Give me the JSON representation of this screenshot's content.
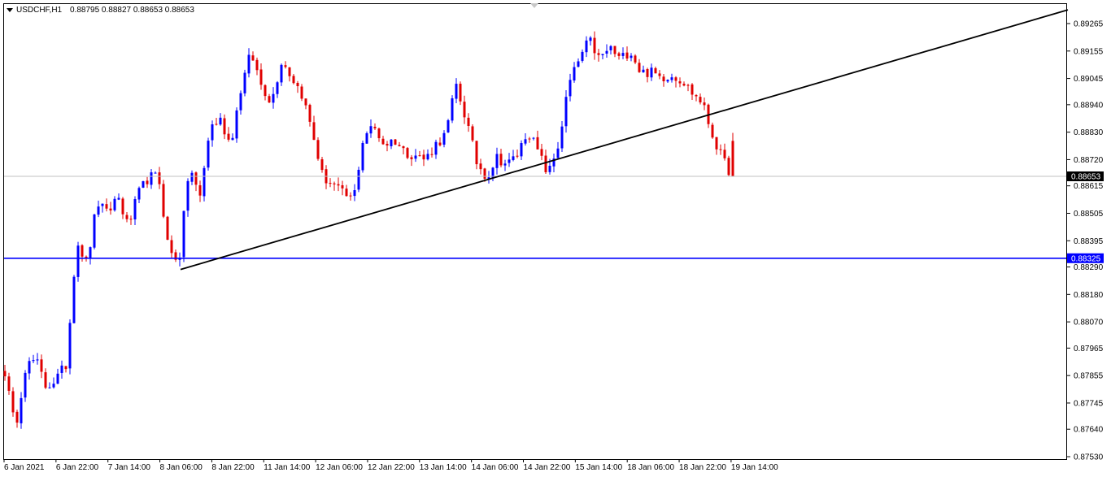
{
  "header": {
    "symbol_timeframe": "USDCHF,H1",
    "ohlc": "0.88795 0.88827 0.88653 0.88653"
  },
  "colors": {
    "bull": "#0000ff",
    "bear": "#e00000",
    "grid_frame": "#000000",
    "horizontal_level": "#0000ff",
    "bid_line": "#c0c0c0"
  },
  "chart_data": {
    "type": "candlestick",
    "symbol": "USDCHF",
    "timeframe": "H1",
    "y_ticks": [
      "0.89265",
      "0.89155",
      "0.89045",
      "0.88940",
      "0.88830",
      "0.88720",
      "0.88615",
      "0.88505",
      "0.88395",
      "0.88290",
      "0.88180",
      "0.88070",
      "0.87965",
      "0.87855",
      "0.87745",
      "0.87640",
      "0.87530"
    ],
    "x_ticks": [
      "6 Jan 2021",
      "6 Jan 22:00",
      "7 Jan 14:00",
      "8 Jan 06:00",
      "8 Jan 22:00",
      "11 Jan 14:00",
      "12 Jan 06:00",
      "12 Jan 22:00",
      "13 Jan 14:00",
      "14 Jan 06:00",
      "14 Jan 22:00",
      "15 Jan 14:00",
      "18 Jan 06:00",
      "18 Jan 22:00",
      "19 Jan 14:00"
    ],
    "ylim": [
      0.8753,
      0.8933
    ],
    "current_price": "0.88653",
    "horizontal_level": "0.88325",
    "trendline": {
      "from_price": 0.8828,
      "to_price": 0.8932
    },
    "close_anchors": [
      0.8787,
      0.8764,
      0.8789,
      0.8792,
      0.8781,
      0.8784,
      0.879,
      0.884,
      0.883,
      0.8855,
      0.885,
      0.8858,
      0.8845,
      0.8858,
      0.8865,
      0.8865,
      0.8835,
      0.8832,
      0.887,
      0.8856,
      0.8885,
      0.8888,
      0.8878,
      0.89,
      0.8915,
      0.8902,
      0.8895,
      0.8912,
      0.8905,
      0.8898,
      0.8883,
      0.8865,
      0.8862,
      0.8858,
      0.8856,
      0.8882,
      0.8885,
      0.8878,
      0.888,
      0.8875,
      0.8874,
      0.8872,
      0.8878,
      0.8882,
      0.8902,
      0.8888,
      0.8871,
      0.8865,
      0.8873,
      0.887,
      0.8874,
      0.8884,
      0.8875,
      0.8866,
      0.8878,
      0.8902,
      0.8912,
      0.892,
      0.8912,
      0.8917,
      0.8912,
      0.8916,
      0.8907,
      0.8907,
      0.8905,
      0.8906,
      0.8904,
      0.8899,
      0.8895,
      0.8882,
      0.8872,
      0.88653
    ]
  }
}
